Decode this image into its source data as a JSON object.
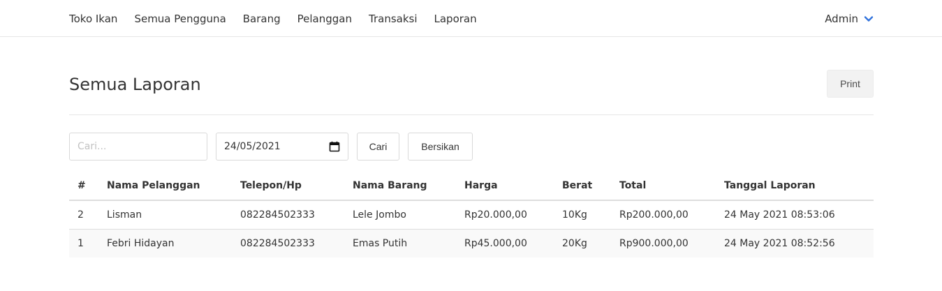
{
  "navbar": {
    "brand": "Toko Ikan",
    "links": [
      "Semua Pengguna",
      "Barang",
      "Pelanggan",
      "Transaksi",
      "Laporan"
    ],
    "user_label": "Admin",
    "user_icon": "chevron-down-icon",
    "accent_color": "#3273dc"
  },
  "page": {
    "title": "Semua Laporan",
    "print_label": "Print"
  },
  "filters": {
    "search_placeholder": "Cari...",
    "search_value": "",
    "date_value": "24/05/2021",
    "search_button": "Cari",
    "clear_button": "Bersikan"
  },
  "table": {
    "columns": [
      "#",
      "Nama Pelanggan",
      "Telepon/Hp",
      "Nama Barang",
      "Harga",
      "Berat",
      "Total",
      "Tanggal Laporan"
    ],
    "rows": [
      [
        "2",
        "Lisman",
        "082284502333",
        "Lele Jombo",
        "Rp20.000,00",
        "10Kg",
        "Rp200.000,00",
        "24 May 2021 08:53:06"
      ],
      [
        "1",
        "Febri Hidayan",
        "082284502333",
        "Emas Putih",
        "Rp45.000,00",
        "20Kg",
        "Rp900.000,00",
        "24 May 2021 08:52:56"
      ]
    ]
  }
}
